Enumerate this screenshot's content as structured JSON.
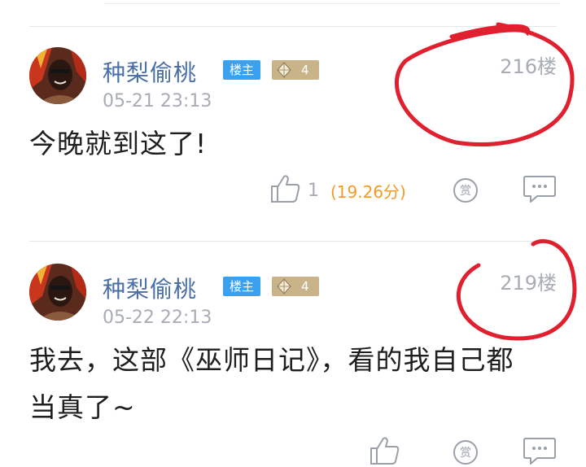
{
  "posts": [
    {
      "username": "种梨偷桃",
      "owner_badge": "楼主",
      "level": "4",
      "timestamp": "05-21 23:13",
      "floor": "216楼",
      "content": "今晚就到这了!",
      "like_count": "1",
      "score": "(19.26分)"
    },
    {
      "username": "种梨偷桃",
      "owner_badge": "楼主",
      "level": "4",
      "timestamp": "05-22 22:13",
      "floor": "219楼",
      "content_line1": "我去，这部《巫师日记》，看的我自己都",
      "content_line2": "当真了~"
    }
  ],
  "icons": {
    "like": "thumbs-up-icon",
    "reward": "reward-coin-icon",
    "comment": "comment-bubble-icon",
    "level": "gem-icon"
  },
  "colors": {
    "username": "#4a6fa5",
    "owner_badge": "#3aa0f0",
    "level_badge": "#c9b48a",
    "score": "#f59a23",
    "annotation": "#e0202f",
    "muted": "#a8adb5"
  }
}
